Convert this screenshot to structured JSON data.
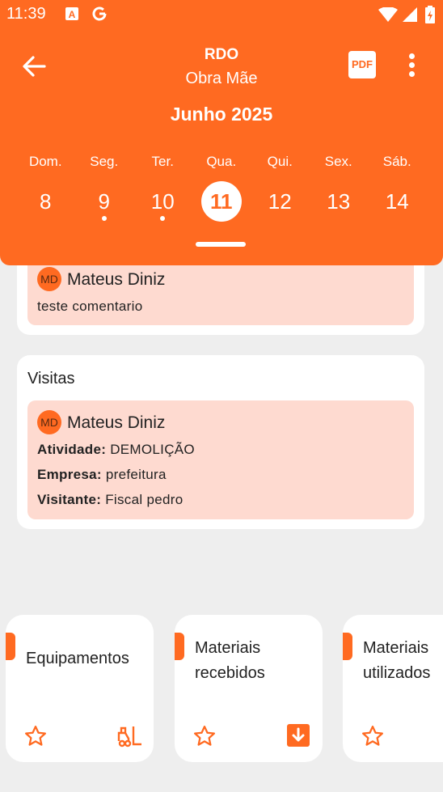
{
  "status": {
    "time": "11:39"
  },
  "header": {
    "title": "RDO",
    "subtitle": "Obra Mãe",
    "pdf_label": "PDF",
    "month": "Junho 2025",
    "days": [
      {
        "name": "Dom.",
        "num": "8",
        "dot": false,
        "selected": false
      },
      {
        "name": "Seg.",
        "num": "9",
        "dot": true,
        "selected": false
      },
      {
        "name": "Ter.",
        "num": "10",
        "dot": true,
        "selected": false
      },
      {
        "name": "Qua.",
        "num": "11",
        "dot": false,
        "selected": true
      },
      {
        "name": "Qui.",
        "num": "12",
        "dot": false,
        "selected": false
      },
      {
        "name": "Sex.",
        "num": "13",
        "dot": false,
        "selected": false
      },
      {
        "name": "Sáb.",
        "num": "14",
        "dot": false,
        "selected": false
      }
    ]
  },
  "comments": {
    "avatar": "MD",
    "user": "Mateus Diniz",
    "text": "teste comentario"
  },
  "visits": {
    "title": "Visitas",
    "avatar": "MD",
    "user": "Mateus Diniz",
    "activity_label": "Atividade:",
    "activity": "DEMOLIÇÃO",
    "company_label": "Empresa:",
    "company": "prefeitura",
    "visitor_label": "Visitante:",
    "visitor": "Fiscal pedro"
  },
  "tiles": [
    {
      "label": "Equipamentos",
      "icon": "forklift-icon"
    },
    {
      "label": "Materiais recebidos",
      "icon": "download-icon"
    },
    {
      "label": "Materiais utilizados",
      "icon": ""
    }
  ],
  "colors": {
    "accent": "#ff6a21",
    "inner": "#fedad0",
    "background": "#eeeeee"
  }
}
